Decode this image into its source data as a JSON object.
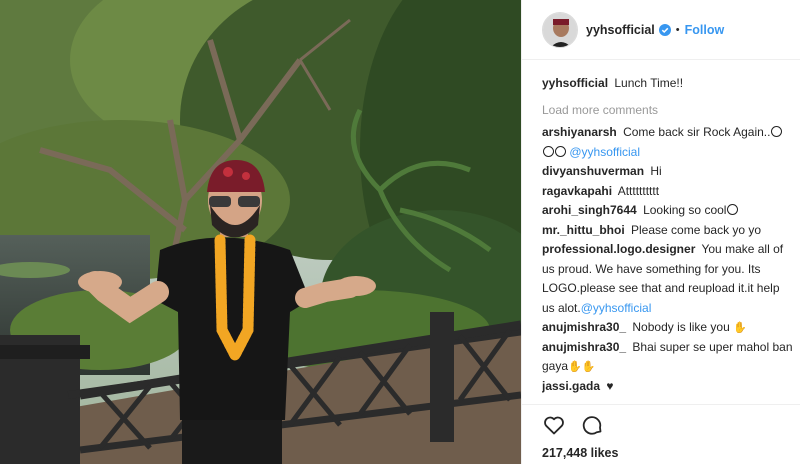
{
  "post": {
    "username": "yyhsofficial",
    "separator": "•",
    "follow_label": "Follow",
    "caption": {
      "username": "yyhsofficial",
      "text": "Lunch Time!!"
    },
    "load_more_label": "Load more comments",
    "comments": [
      {
        "username": "arshiyanarsh",
        "text": "Come back sir Rock Again..",
        "mention": "@yyhsofficial"
      },
      {
        "username": "divyanshuverman",
        "text": "Hi"
      },
      {
        "username": "ragavkapahi",
        "text": "Atttttttttt"
      },
      {
        "username": "arohi_singh7644",
        "text": "Looking so cool"
      },
      {
        "username": "mr._hittu_bhoi",
        "text": "Please come back yo yo"
      },
      {
        "username": "professional.logo.designer",
        "text": "You make all of us proud. We have something for you. Its LOGO.please see that and reupload it.it help us alot.",
        "mention": "@yyhsofficial"
      },
      {
        "username": "anujmishra30_",
        "text": "Nobody is like you"
      },
      {
        "username": "anujmishra30_",
        "text": "Bhai super se uper mahol ban gaya"
      },
      {
        "username": "jassi.gada",
        "text": "♥"
      }
    ],
    "likes": "217,448 likes",
    "icons": {
      "verified": "verified-badge-icon",
      "like": "heart-outline-icon",
      "comment": "speech-bubble-icon",
      "avatar": "profile-avatar"
    },
    "colors": {
      "link_blue": "#3897f0",
      "text": "#262626",
      "muted": "#999999",
      "border": "#efefef"
    }
  }
}
